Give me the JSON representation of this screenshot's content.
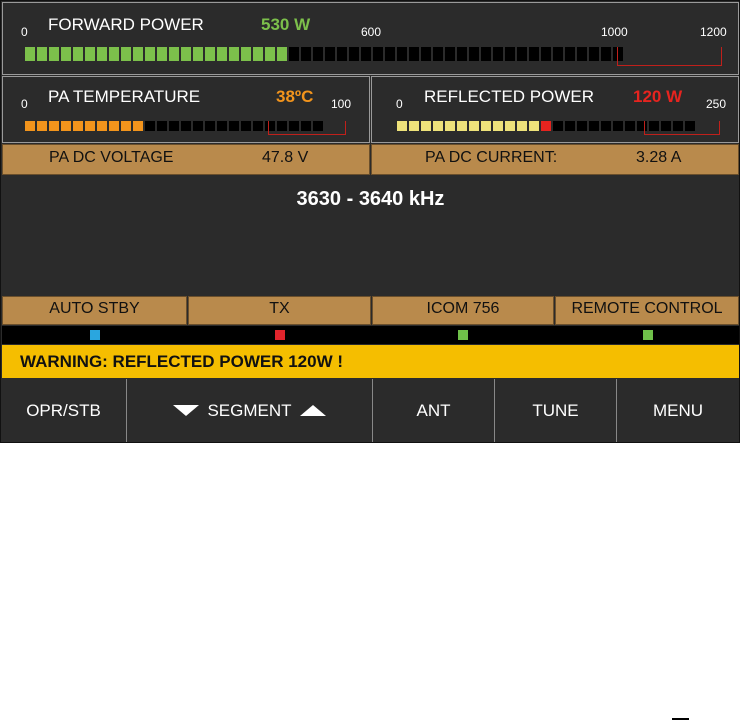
{
  "forward_power": {
    "title": "FORWARD POWER",
    "readout": "530 W",
    "scale": {
      "min": "0",
      "mid": "600",
      "high": "1000",
      "max": "1200"
    },
    "level_fraction": 0.44
  },
  "pa_temperature": {
    "title": "PA TEMPERATURE",
    "readout": "38ºC",
    "scale": {
      "min": "0",
      "max": "100"
    },
    "level_fraction": 0.38
  },
  "reflected_power": {
    "title": "REFLECTED POWER",
    "readout": "120 W",
    "scale": {
      "min": "0",
      "max": "250"
    },
    "level_fraction": 0.48
  },
  "dc_voltage": {
    "label": "PA DC VOLTAGE",
    "value": "47.8 V"
  },
  "dc_current": {
    "label": "PA DC CURRENT:",
    "value": "3.28 A"
  },
  "frequency": "3630 - 3640 kHz",
  "status": [
    {
      "label": "AUTO STBY",
      "led_color": "#2aa6df"
    },
    {
      "label": "TX",
      "led_color": "#e0242c"
    },
    {
      "label": "ICOM 756",
      "led_color": "#6fc04a"
    },
    {
      "label": "REMOTE CONTROL",
      "led_color": "#6fc04a"
    }
  ],
  "warning": "WARNING: REFLECTED POWER 120W !",
  "buttons": {
    "opr_stb": "OPR/STB",
    "segment": "SEGMENT",
    "ant": "ANT",
    "tune": "TUNE",
    "menu": "MENU"
  },
  "colors": {
    "forward": "#7cc04b",
    "temperature": "#f2941c",
    "reflected_bar": "#eee27a",
    "reflected_text": "#e6241f",
    "strip": "#b98a4c",
    "warning": "#f5be00"
  }
}
